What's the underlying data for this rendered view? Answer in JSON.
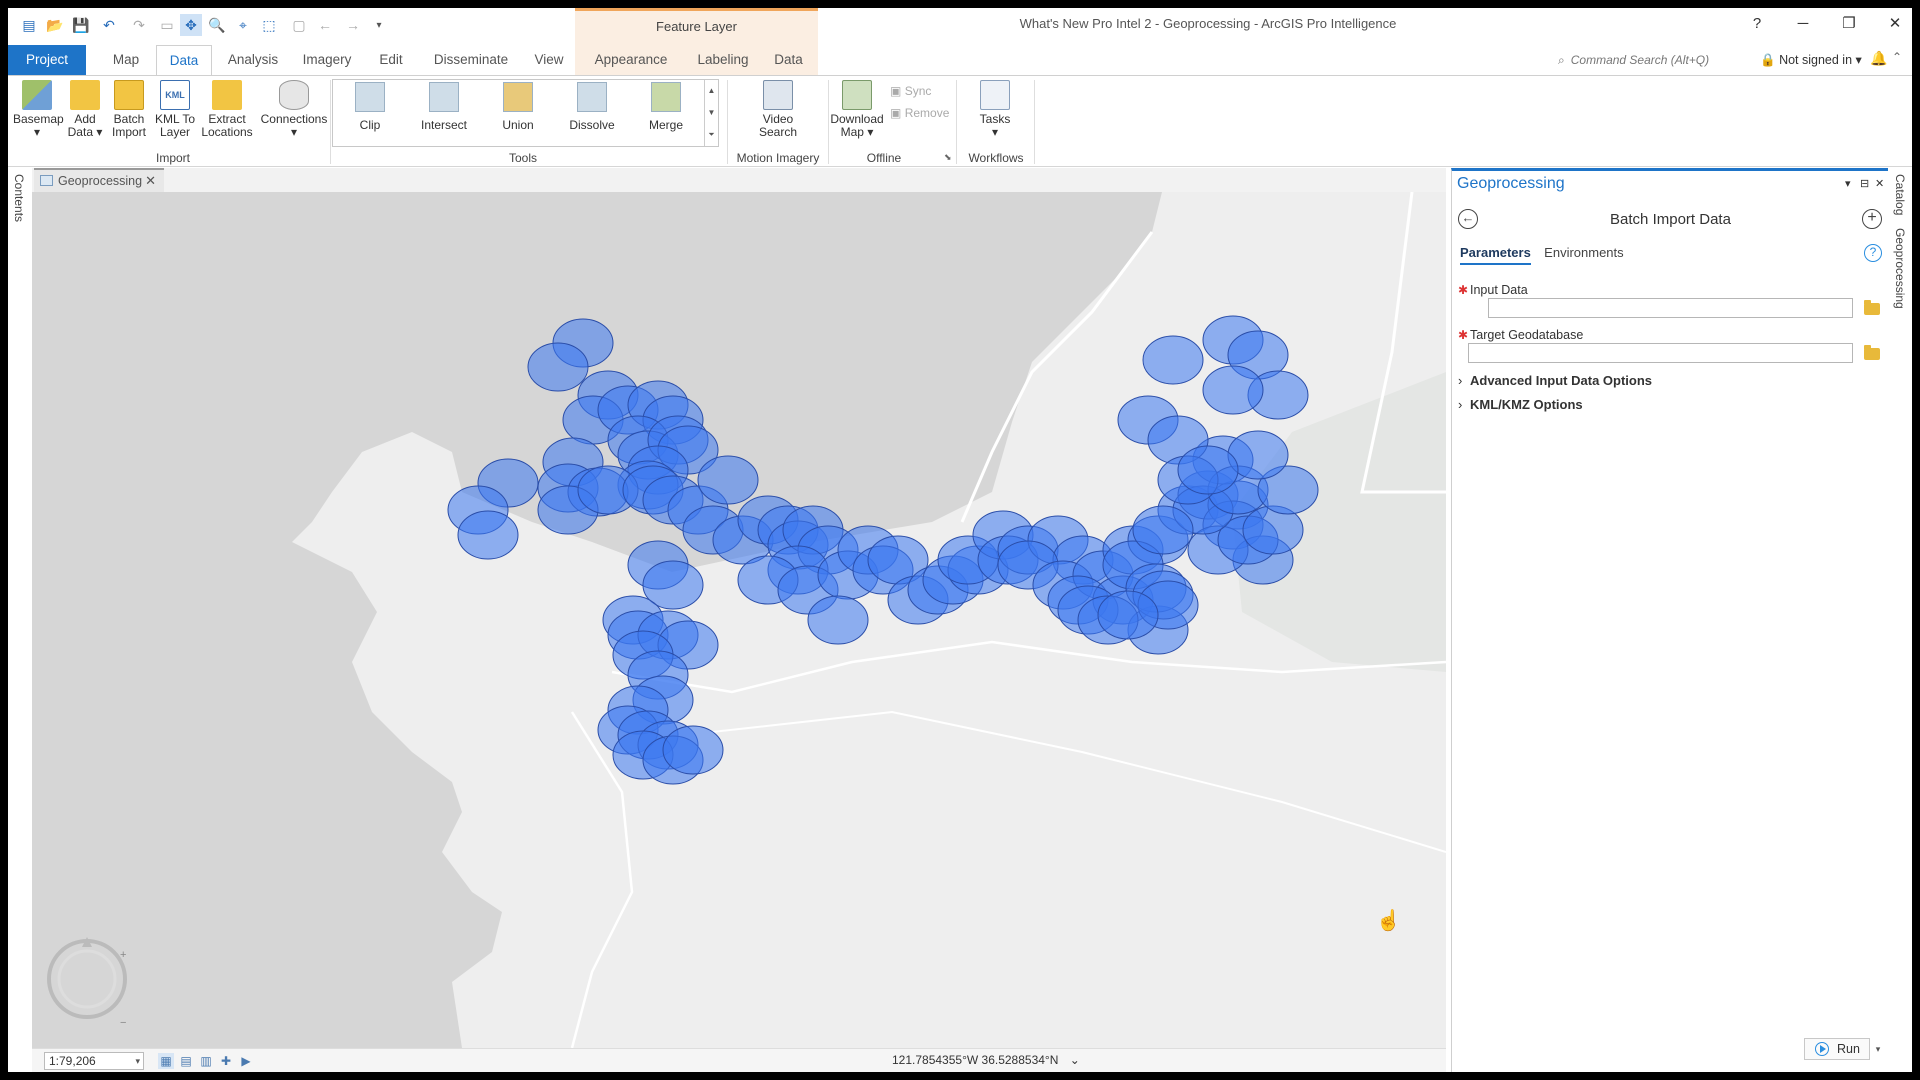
{
  "window": {
    "title": "What's New Pro Intel 2 - Geoprocessing - ArcGIS Pro Intelligence",
    "context_tab_group": "Feature Layer",
    "help": "?",
    "minimize": "─",
    "restore": "❐",
    "close": "✕"
  },
  "tabs": [
    "Project",
    "Map",
    "Data",
    "Analysis",
    "Imagery",
    "Edit",
    "Disseminate",
    "View",
    "Appearance",
    "Labeling",
    "Data"
  ],
  "command_search": {
    "placeholder": "Command Search (Alt+Q)"
  },
  "account": {
    "label": "Not signed in"
  },
  "ribbon": {
    "import": {
      "label": "Import",
      "buttons": [
        {
          "l1": "Basemap",
          "l2": "▾"
        },
        {
          "l1": "Add",
          "l2": "Data ▾"
        },
        {
          "l1": "Batch",
          "l2": "Import"
        },
        {
          "l1": "KML To",
          "l2": "Layer"
        },
        {
          "l1": "Extract",
          "l2": "Locations"
        },
        {
          "l1": "Connections",
          "l2": "▾"
        }
      ]
    },
    "tools": {
      "label": "Tools",
      "buttons": [
        "Clip",
        "Intersect",
        "Union",
        "Dissolve",
        "Merge"
      ]
    },
    "motion_imagery": {
      "label": "Motion Imagery",
      "button_l1": "Video",
      "button_l2": "Search"
    },
    "offline": {
      "label": "Offline",
      "download_l1": "Download",
      "download_l2": "Map ▾",
      "sync": "Sync",
      "remove": "Remove"
    },
    "workflows": {
      "label": "Workflows",
      "tasks_l1": "Tasks",
      "tasks_l2": "▾"
    }
  },
  "contents_label": "Contents",
  "map": {
    "tab_label": "Geoprocessing",
    "scale": "1:79,206",
    "coordinates": "121.7854355°W 36.5288534°N",
    "colors": {
      "water": "#d6d6d6",
      "land": "#eeeeee",
      "buffer_fill": "#3d78f0",
      "buffer_stroke": "#2a4da8"
    }
  },
  "geoprocessing": {
    "title": "Geoprocessing",
    "tool_title": "Batch Import Data",
    "tabs": [
      "Parameters",
      "Environments"
    ],
    "params": [
      {
        "label": "Input Data",
        "value": ""
      },
      {
        "label": "Target Geodatabase",
        "value": ""
      }
    ],
    "expanders": [
      "Advanced Input Data Options",
      "KML/KMZ Options"
    ],
    "run_label": "Run"
  },
  "right_strip": {
    "catalog": "Catalog",
    "geoprocessing": "Geoprocessing"
  }
}
